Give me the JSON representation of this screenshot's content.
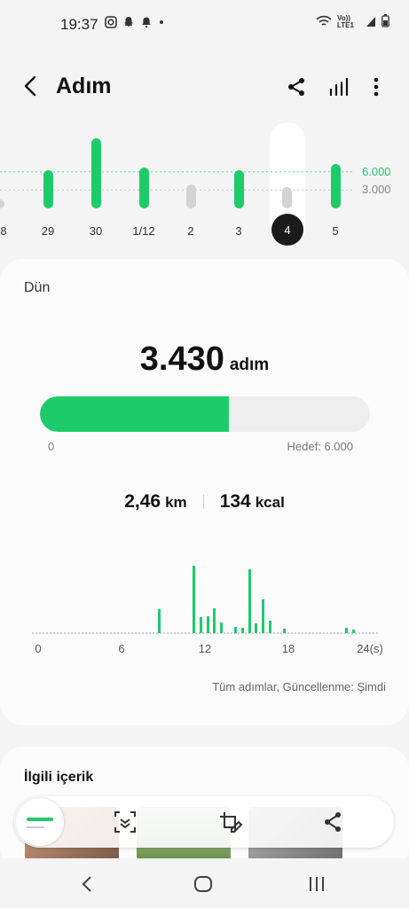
{
  "status": {
    "time": "19:37",
    "network": "Vo)) LTE1"
  },
  "header": {
    "title": "Adım"
  },
  "week_chart": {
    "reference_lines": [
      {
        "label": "6.000",
        "color": "#1ecb6b"
      },
      {
        "label": "3.000",
        "color": "#888888"
      }
    ],
    "days": [
      {
        "label": "8",
        "steps": 1200,
        "goal_met": false
      },
      {
        "label": "29",
        "steps": 6300,
        "goal_met": true
      },
      {
        "label": "30",
        "steps": 11500,
        "goal_met": true
      },
      {
        "label": "1/12",
        "steps": 6700,
        "goal_met": true
      },
      {
        "label": "2",
        "steps": 3900,
        "goal_met": false
      },
      {
        "label": "3",
        "steps": 6200,
        "goal_met": true
      },
      {
        "label": "4",
        "steps": 3430,
        "goal_met": false,
        "selected": true
      },
      {
        "label": "5",
        "steps": 7300,
        "goal_met": true
      }
    ]
  },
  "summary": {
    "day_label": "Dün",
    "steps": "3.430",
    "steps_unit": "adım",
    "progress_fraction": 0.5717,
    "progress_min": "0",
    "progress_goal": "Hedef: 6.000",
    "distance": "2,46",
    "distance_unit": "km",
    "calories": "134",
    "calories_unit": "kcal",
    "footer": "Tüm adımlar, Güncellenme: Şimdi"
  },
  "hourly_chart": {
    "x_ticks": [
      "0",
      "6",
      "12",
      "18",
      "24(s)"
    ],
    "x_range": [
      0,
      24
    ],
    "bars": [
      {
        "hour": 8.7,
        "value": 28
      },
      {
        "hour": 11.2,
        "value": 78
      },
      {
        "hour": 11.7,
        "value": 18
      },
      {
        "hour": 12.2,
        "value": 19
      },
      {
        "hour": 12.7,
        "value": 29
      },
      {
        "hour": 13.2,
        "value": 12
      },
      {
        "hour": 14.2,
        "value": 7
      },
      {
        "hour": 14.7,
        "value": 6
      },
      {
        "hour": 15.2,
        "value": 74
      },
      {
        "hour": 15.7,
        "value": 11
      },
      {
        "hour": 16.2,
        "value": 39
      },
      {
        "hour": 16.7,
        "value": 14
      },
      {
        "hour": 17.7,
        "value": 5
      },
      {
        "hour": 22.2,
        "value": 6
      },
      {
        "hour": 22.7,
        "value": 4
      }
    ]
  },
  "related": {
    "title": "İlgili içerik"
  },
  "colors": {
    "accent": "#1ecb6b",
    "inactive": "#d3d3d3",
    "dark": "#1b1b1b"
  }
}
